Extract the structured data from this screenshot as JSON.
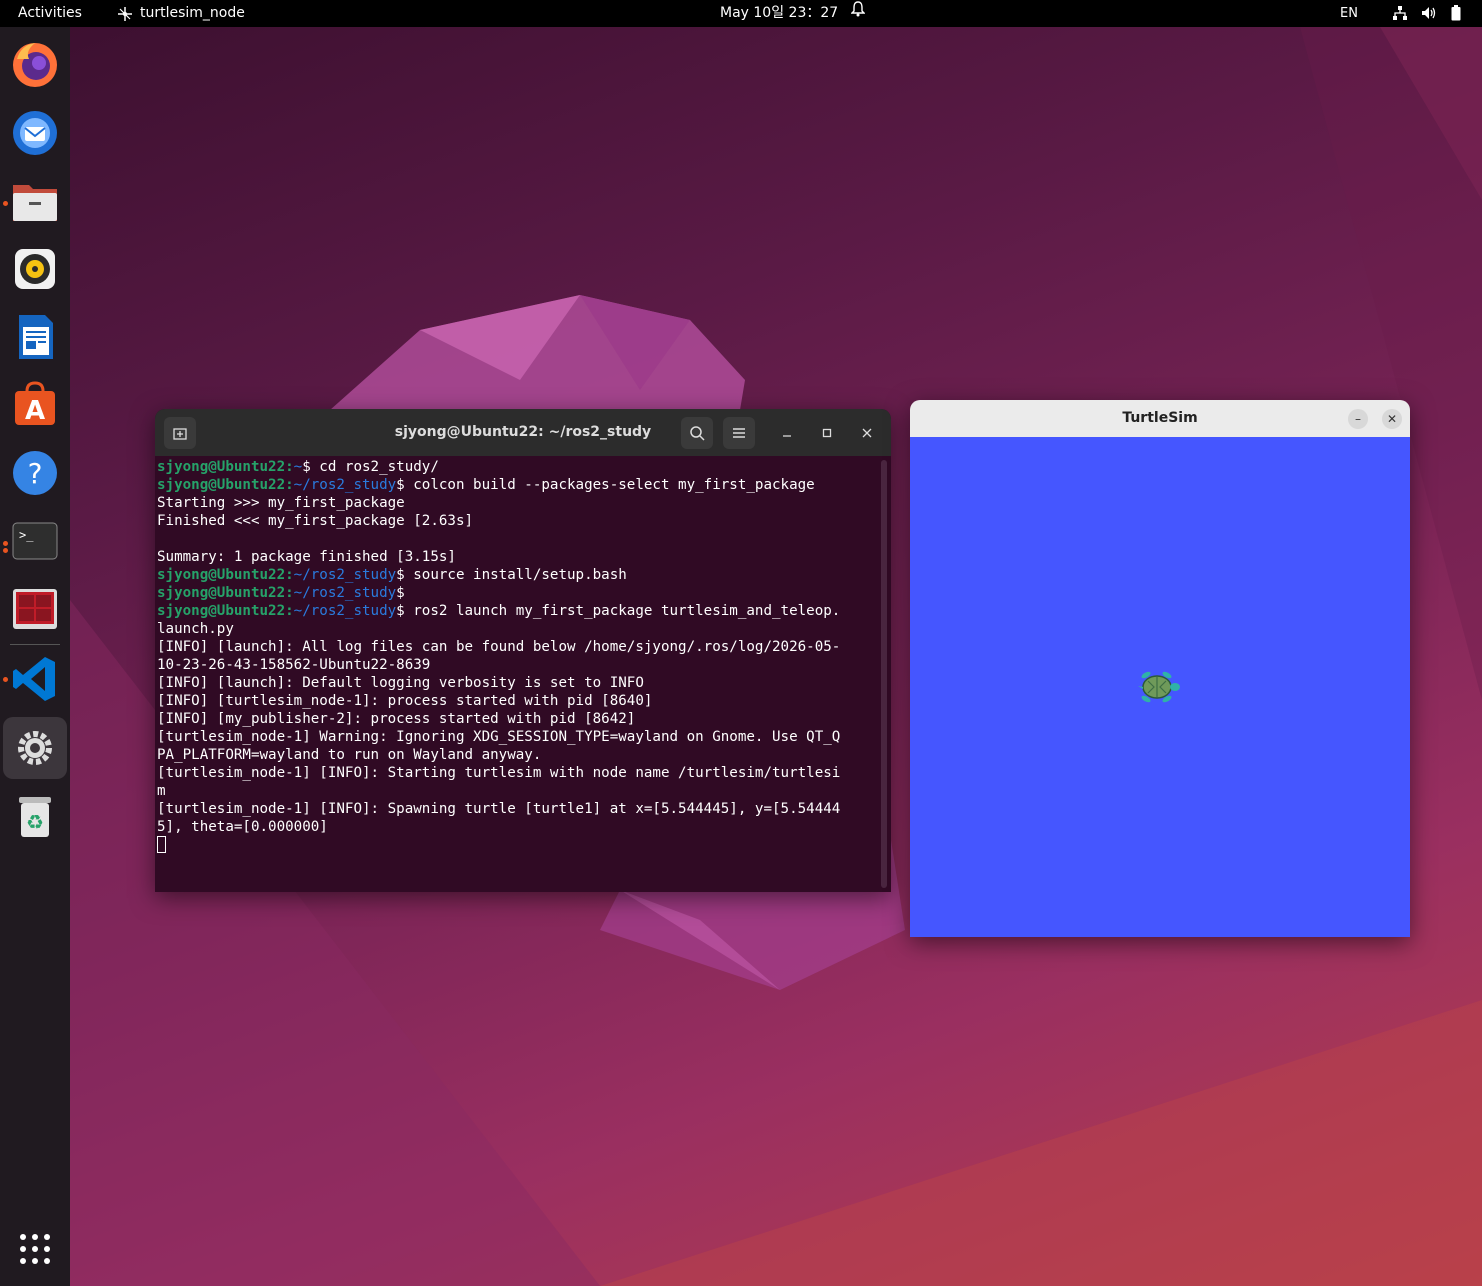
{
  "topbar": {
    "activities": "Activities",
    "app_name": "turtlesim_node",
    "clock": "May 10일  23：27",
    "lang": "EN",
    "icons": [
      "app-indicator-icon",
      "bell-icon",
      "network-icon",
      "volume-icon",
      "battery-icon"
    ]
  },
  "dock": {
    "items": [
      "firefox",
      "thunderbird",
      "files",
      "rhythmbox",
      "libreoffice-writer",
      "app-center",
      "help",
      "terminal",
      "system-monitor",
      "vscode",
      "settings",
      "trash"
    ],
    "apps_grid": "show-apps-icon"
  },
  "terminal": {
    "title": "sjyong@Ubuntu22: ~/ros2_study",
    "lines": [
      {
        "user": "sjyong@Ubuntu22",
        "path": "~",
        "cmd": "$ cd ros2_study/"
      },
      {
        "user": "sjyong@Ubuntu22",
        "path": "~/ros2_study",
        "cmd": "$ colcon build --packages-select my_first_package"
      },
      {
        "text": "Starting >>> my_first_package"
      },
      {
        "text": "Finished <<< my_first_package [2.63s]"
      },
      {
        "text": ""
      },
      {
        "text": "Summary: 1 package finished [3.15s]"
      },
      {
        "user": "sjyong@Ubuntu22",
        "path": "~/ros2_study",
        "cmd": "$ source install/setup.bash"
      },
      {
        "user": "sjyong@Ubuntu22",
        "path": "~/ros2_study",
        "cmd": "$"
      },
      {
        "user": "sjyong@Ubuntu22",
        "path": "~/ros2_study",
        "cmd": "$ ros2 launch my_first_package turtlesim_and_teleop."
      },
      {
        "text": "launch.py"
      },
      {
        "text": "[INFO] [launch]: All log files can be found below /home/sjyong/.ros/log/2026-05-"
      },
      {
        "text": "10-23-26-43-158562-Ubuntu22-8639"
      },
      {
        "text": "[INFO] [launch]: Default logging verbosity is set to INFO"
      },
      {
        "text": "[INFO] [turtlesim_node-1]: process started with pid [8640]"
      },
      {
        "text": "[INFO] [my_publisher-2]: process started with pid [8642]"
      },
      {
        "text": "[turtlesim_node-1] Warning: Ignoring XDG_SESSION_TYPE=wayland on Gnome. Use QT_Q"
      },
      {
        "text": "PA_PLATFORM=wayland to run on Wayland anyway."
      },
      {
        "text": "[turtlesim_node-1] [INFO]: Starting turtlesim with node name /turtlesim/turtlesi"
      },
      {
        "text": "m"
      },
      {
        "text": "[turtlesim_node-1] [INFO]: Spawning turtle [turtle1] at x=[5.544445], y=[5.54444"
      },
      {
        "text": "5], theta=[0.000000]"
      }
    ]
  },
  "turtlesim": {
    "title": "TurtleSim",
    "minimize": "–",
    "close": "✕",
    "bg_color": "#4556ff"
  }
}
